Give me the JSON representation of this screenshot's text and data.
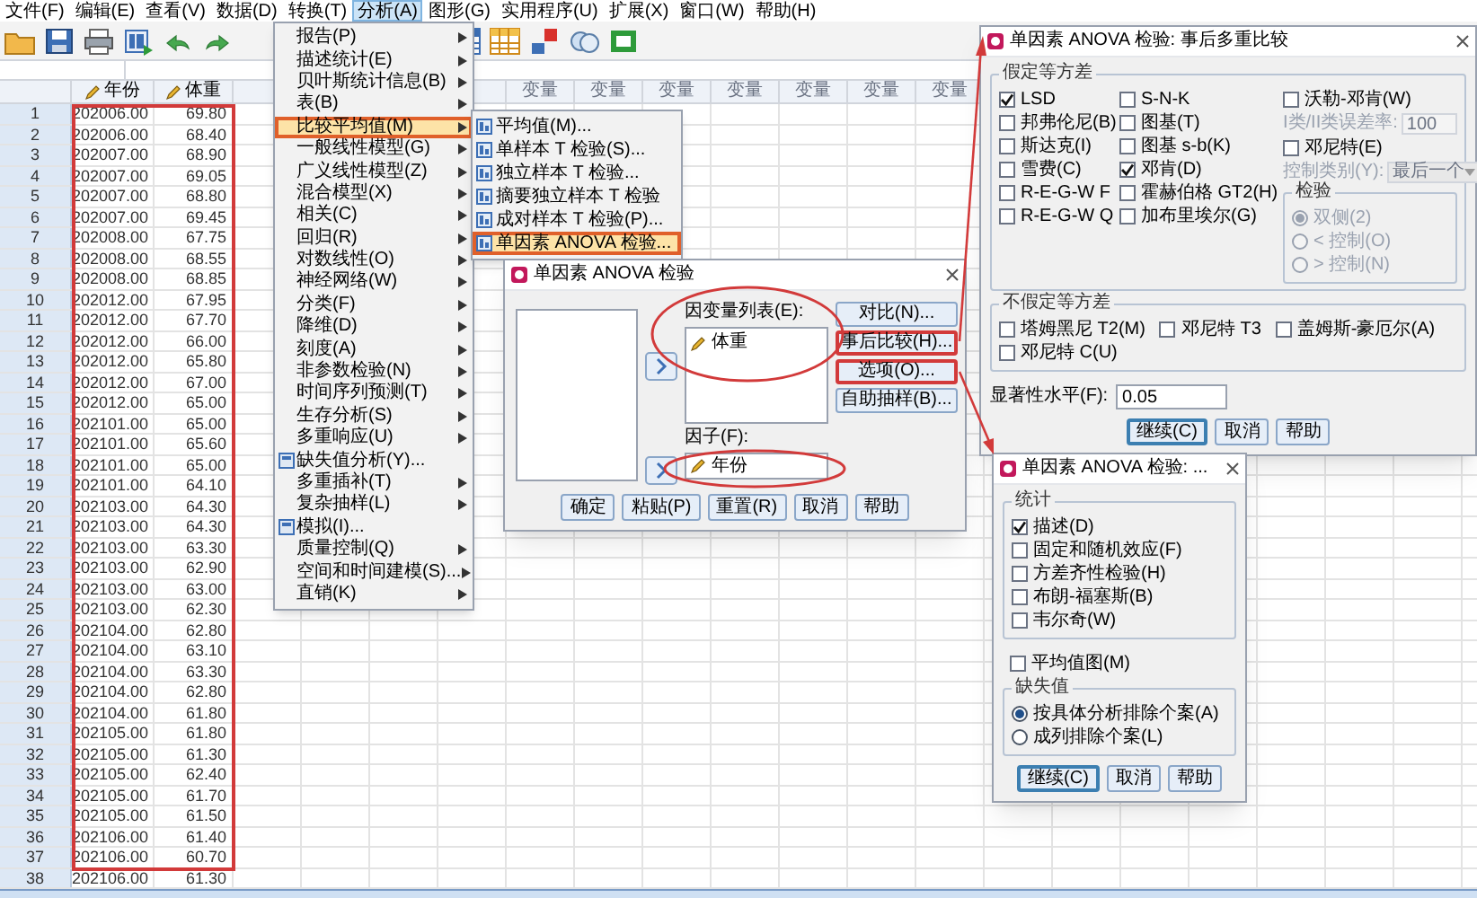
{
  "menu_bar": [
    {
      "label": "文件(F)",
      "selected": false
    },
    {
      "label": "编辑(E)",
      "selected": false
    },
    {
      "label": "查看(V)",
      "selected": false
    },
    {
      "label": "数据(D)",
      "selected": false
    },
    {
      "label": "转换(T)",
      "selected": false
    },
    {
      "label": "分析(A)",
      "selected": true
    },
    {
      "label": "图形(G)",
      "selected": false
    },
    {
      "label": "实用程序(U)",
      "selected": false
    },
    {
      "label": "扩展(X)",
      "selected": false
    },
    {
      "label": "窗口(W)",
      "selected": false
    },
    {
      "label": "帮助(H)",
      "selected": false
    }
  ],
  "grid": {
    "columns": [
      "年份",
      "体重"
    ],
    "variable_headers": [
      "变量",
      "变量",
      "变量",
      "变量",
      "变量",
      "变量",
      "变量"
    ],
    "rows": [
      {
        "number": "1",
        "cells": [
          "202006.00",
          "69.80"
        ]
      },
      {
        "number": "2",
        "cells": [
          "202006.00",
          "68.40"
        ]
      },
      {
        "number": "3",
        "cells": [
          "202007.00",
          "68.90"
        ]
      },
      {
        "number": "4",
        "cells": [
          "202007.00",
          "69.05"
        ]
      },
      {
        "number": "5",
        "cells": [
          "202007.00",
          "68.80"
        ]
      },
      {
        "number": "6",
        "cells": [
          "202007.00",
          "69.45"
        ]
      },
      {
        "number": "7",
        "cells": [
          "202008.00",
          "67.75"
        ]
      },
      {
        "number": "8",
        "cells": [
          "202008.00",
          "68.55"
        ]
      },
      {
        "number": "9",
        "cells": [
          "202008.00",
          "68.85"
        ]
      },
      {
        "number": "10",
        "cells": [
          "202012.00",
          "67.95"
        ]
      },
      {
        "number": "11",
        "cells": [
          "202012.00",
          "67.70"
        ]
      },
      {
        "number": "12",
        "cells": [
          "202012.00",
          "66.00"
        ]
      },
      {
        "number": "13",
        "cells": [
          "202012.00",
          "65.80"
        ]
      },
      {
        "number": "14",
        "cells": [
          "202012.00",
          "67.00"
        ]
      },
      {
        "number": "15",
        "cells": [
          "202012.00",
          "65.00"
        ]
      },
      {
        "number": "16",
        "cells": [
          "202101.00",
          "65.00"
        ]
      },
      {
        "number": "17",
        "cells": [
          "202101.00",
          "65.60"
        ]
      },
      {
        "number": "18",
        "cells": [
          "202101.00",
          "65.00"
        ]
      },
      {
        "number": "19",
        "cells": [
          "202101.00",
          "64.10"
        ]
      },
      {
        "number": "20",
        "cells": [
          "202103.00",
          "64.30"
        ]
      },
      {
        "number": "21",
        "cells": [
          "202103.00",
          "64.30"
        ]
      },
      {
        "number": "22",
        "cells": [
          "202103.00",
          "63.30"
        ]
      },
      {
        "number": "23",
        "cells": [
          "202103.00",
          "62.90"
        ]
      },
      {
        "number": "24",
        "cells": [
          "202103.00",
          "63.00"
        ]
      },
      {
        "number": "25",
        "cells": [
          "202103.00",
          "62.30"
        ]
      },
      {
        "number": "26",
        "cells": [
          "202104.00",
          "62.80"
        ]
      },
      {
        "number": "27",
        "cells": [
          "202104.00",
          "63.10"
        ]
      },
      {
        "number": "28",
        "cells": [
          "202104.00",
          "63.30"
        ]
      },
      {
        "number": "29",
        "cells": [
          "202104.00",
          "62.80"
        ]
      },
      {
        "number": "30",
        "cells": [
          "202104.00",
          "61.80"
        ]
      },
      {
        "number": "31",
        "cells": [
          "202105.00",
          "61.80"
        ]
      },
      {
        "number": "32",
        "cells": [
          "202105.00",
          "61.30"
        ]
      },
      {
        "number": "33",
        "cells": [
          "202105.00",
          "62.40"
        ]
      },
      {
        "number": "34",
        "cells": [
          "202105.00",
          "61.70"
        ]
      },
      {
        "number": "35",
        "cells": [
          "202105.00",
          "61.50"
        ]
      },
      {
        "number": "36",
        "cells": [
          "202106.00",
          "61.40"
        ]
      },
      {
        "number": "37",
        "cells": [
          "202106.00",
          "60.70"
        ]
      },
      {
        "number": "38",
        "cells": [
          "202106.00",
          "61.30"
        ]
      }
    ]
  },
  "analyze_menu": [
    {
      "label": "报告(P)",
      "kind": "plain",
      "submenu": true,
      "selected": false
    },
    {
      "label": "描述统计(E)",
      "kind": "plain",
      "submenu": true,
      "selected": false
    },
    {
      "label": "贝叶斯统计信息(B)",
      "kind": "plain",
      "submenu": true,
      "selected": false
    },
    {
      "label": "表(B)",
      "kind": "plain",
      "submenu": true,
      "selected": false
    },
    {
      "label": "比较平均值(M)",
      "kind": "plain",
      "submenu": true,
      "selected": true
    },
    {
      "label": "一般线性模型(G)",
      "kind": "plain",
      "submenu": true,
      "selected": false
    },
    {
      "label": "广义线性模型(Z)",
      "kind": "plain",
      "submenu": true,
      "selected": false
    },
    {
      "label": "混合模型(X)",
      "kind": "plain",
      "submenu": true,
      "selected": false
    },
    {
      "label": "相关(C)",
      "kind": "plain",
      "submenu": true,
      "selected": false
    },
    {
      "label": "回归(R)",
      "kind": "plain",
      "submenu": true,
      "selected": false
    },
    {
      "label": "对数线性(O)",
      "kind": "plain",
      "submenu": true,
      "selected": false
    },
    {
      "label": "神经网络(W)",
      "kind": "plain",
      "submenu": true,
      "selected": false
    },
    {
      "label": "分类(F)",
      "kind": "plain",
      "submenu": true,
      "selected": false
    },
    {
      "label": "降维(D)",
      "kind": "plain",
      "submenu": true,
      "selected": false
    },
    {
      "label": "刻度(A)",
      "kind": "plain",
      "submenu": true,
      "selected": false
    },
    {
      "label": "非参数检验(N)",
      "kind": "plain",
      "submenu": true,
      "selected": false
    },
    {
      "label": "时间序列预测(T)",
      "kind": "plain",
      "submenu": true,
      "selected": false
    },
    {
      "label": "生存分析(S)",
      "kind": "plain",
      "submenu": true,
      "selected": false
    },
    {
      "label": "多重响应(U)",
      "kind": "plain",
      "submenu": true,
      "selected": false
    },
    {
      "label": "缺失值分析(Y)...",
      "kind": "icon",
      "submenu": false,
      "selected": false
    },
    {
      "label": "多重插补(T)",
      "kind": "plain",
      "submenu": true,
      "selected": false
    },
    {
      "label": "复杂抽样(L)",
      "kind": "plain",
      "submenu": true,
      "selected": false
    },
    {
      "label": "模拟(I)...",
      "kind": "icon",
      "submenu": false,
      "selected": false
    },
    {
      "label": "质量控制(Q)",
      "kind": "plain",
      "submenu": true,
      "selected": false
    },
    {
      "label": "空间和时间建模(S)...",
      "kind": "plain",
      "submenu": true,
      "selected": false
    },
    {
      "label": "直销(K)",
      "kind": "plain",
      "submenu": true,
      "selected": false
    }
  ],
  "compare_means_menu": [
    {
      "label": "平均值(M)...",
      "selected": false
    },
    {
      "label": "单样本 T 检验(S)...",
      "selected": false
    },
    {
      "label": "独立样本 T 检验...",
      "selected": false
    },
    {
      "label": "摘要独立样本 T 检验",
      "selected": false
    },
    {
      "label": "成对样本 T 检验(P)...",
      "selected": false
    },
    {
      "label": "单因素 ANOVA 检验...",
      "selected": true
    }
  ],
  "anova_dialog": {
    "title": "单因素 ANOVA 检验",
    "dependent_label": "因变量列表(E):",
    "dependent_items": [
      "体重"
    ],
    "factor_label": "因子(F):",
    "factor_value": "年份",
    "side_buttons": [
      {
        "label": "对比(N)...",
        "marked": false
      },
      {
        "label": "事后比较(H)...",
        "marked": true
      },
      {
        "label": "选项(O)...",
        "marked": true
      },
      {
        "label": "自助抽样(B)...",
        "marked": false
      }
    ],
    "buttons": [
      {
        "label": "确定",
        "default": false
      },
      {
        "label": "粘贴(P)",
        "default": false
      },
      {
        "label": "重置(R)",
        "default": false
      },
      {
        "label": "取消",
        "default": false
      },
      {
        "label": "帮助",
        "default": false
      }
    ]
  },
  "post_hoc_dialog": {
    "title": "单因素 ANOVA 检验: 事后多重比较",
    "equal_variances": {
      "legend": "假定等方差",
      "column_1": [
        {
          "label": "LSD",
          "checked": true
        },
        {
          "label": "邦弗伦尼(B)",
          "checked": false
        },
        {
          "label": "斯达克(I)",
          "checked": false
        },
        {
          "label": "雪费(C)",
          "checked": false
        },
        {
          "label": "R-E-G-W F",
          "checked": false
        },
        {
          "label": "R-E-G-W Q",
          "checked": false
        }
      ],
      "column_2": [
        {
          "label": "S-N-K",
          "checked": false
        },
        {
          "label": "图基(T)",
          "checked": false
        },
        {
          "label": "图基 s-b(K)",
          "checked": false
        },
        {
          "label": "邓肯(D)",
          "checked": true
        },
        {
          "label": "霍赫伯格 GT2(H)",
          "checked": false
        },
        {
          "label": "加布里埃尔(G)",
          "checked": false
        }
      ],
      "waller_duncan": {
        "label": "沃勒-邓肯(W)",
        "checked": false
      },
      "error_ratio": {
        "label": "I类/II类误差率:",
        "value": "100",
        "disabled": true
      },
      "dunnett": {
        "label": "邓尼特(E)",
        "checked": false
      },
      "control_category": {
        "label": "控制类别(Y):",
        "value": "最后一个",
        "disabled": true
      },
      "test": {
        "legend": "检验",
        "disabled": true,
        "options": [
          {
            "label": "双侧(2)",
            "selected": true
          },
          {
            "label": "< 控制(O)",
            "selected": false
          },
          {
            "label": "> 控制(N)",
            "selected": false
          }
        ]
      }
    },
    "unequal_variances": {
      "legend": "不假定等方差",
      "items": [
        {
          "label": "塔姆黑尼 T2(M)",
          "checked": false
        },
        {
          "label": "邓尼特 T3",
          "checked": false
        },
        {
          "label": "盖姆斯-豪厄尔(A)",
          "checked": false
        },
        {
          "label": "邓尼特 C(U)",
          "checked": false
        }
      ]
    },
    "significance": {
      "label": "显著性水平(F):",
      "value": "0.05"
    },
    "buttons": [
      {
        "label": "继续(C)",
        "default": true
      },
      {
        "label": "取消",
        "default": false
      },
      {
        "label": "帮助",
        "default": false
      }
    ]
  },
  "options_dialog": {
    "title": "单因素 ANOVA 检验: ...",
    "statistics": {
      "legend": "统计",
      "items": [
        {
          "label": "描述(D)",
          "checked": true
        },
        {
          "label": "固定和随机效应(F)",
          "checked": false
        },
        {
          "label": "方差齐性检验(H)",
          "checked": false
        },
        {
          "label": "布朗-福塞斯(B)",
          "checked": false
        },
        {
          "label": "韦尔奇(W)",
          "checked": false
        }
      ]
    },
    "means_plot": {
      "label": "平均值图(M)",
      "checked": false
    },
    "missing_values": {
      "legend": "缺失值",
      "options": [
        {
          "label": "按具体分析排除个案(A)",
          "selected": true
        },
        {
          "label": "成列排除个案(L)",
          "selected": false
        }
      ]
    },
    "buttons": [
      {
        "label": "继续(C)",
        "default": true
      },
      {
        "label": "取消",
        "default": false
      },
      {
        "label": "帮助",
        "default": false
      }
    ]
  }
}
